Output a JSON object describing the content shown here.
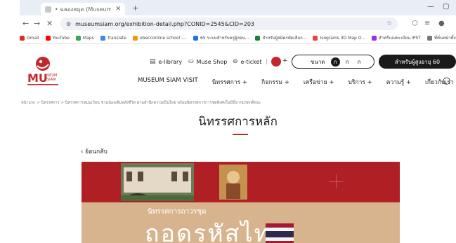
{
  "browser": {
    "tab_title": "• ฉลองสมุด (Museum Siam)",
    "url": "museumsiam.org/exhibition-detail.php?CONID=2545&CID=203",
    "bookmarks": [
      "Gmail",
      "YouTube",
      "Maps",
      "Translate",
      "obecconline school -...",
      "65 ระบบสำหรับครูผู้สอน...",
      "สำหรับผู้สมัครคัดเลือก...",
      "Isograms 3D Map O...",
      "สำหรับลงทะเบียน IPST"
    ],
    "all_bookmarks": "ที่คั่นหน้าทั้งหมด"
  },
  "util": {
    "elibrary": "e-library",
    "shop": "Muse Shop",
    "ticket": "e-ticket",
    "size_label": "ขนาด",
    "fonts": [
      "ก",
      "ก",
      "ก"
    ],
    "elder_button": "สำหรับผู้สูงอายุ 60"
  },
  "nav": [
    "MUSEUM SIAM VISIT",
    "นิทรรศการ +",
    "กิจกรรม +",
    "เครือข่าย +",
    "บริการ +",
    "ความรู้ +",
    "เกี่ยวกับเรา +"
  ],
  "breadcrumb": "หน้าแรก  >  นิทรรศการ  >  นิทรรศการหมุนเวียน ชวนน้องเติมพลังชีวิต ผ่านสำนึกความเป็นไทย พร้อมนิทรรศการการชุดพิเศษในปีนี้จากมรดกศิลปะ",
  "page_title": "นิทรรศการหลัก",
  "back_label": "ย้อนกลับ",
  "hero": {
    "subtitle": "นิทรรศการถาวรชุด",
    "headline": "ถอดรหัสไทย"
  },
  "colors": {
    "brand_red": "#c2272d",
    "hero_band": "#d7b48d"
  }
}
